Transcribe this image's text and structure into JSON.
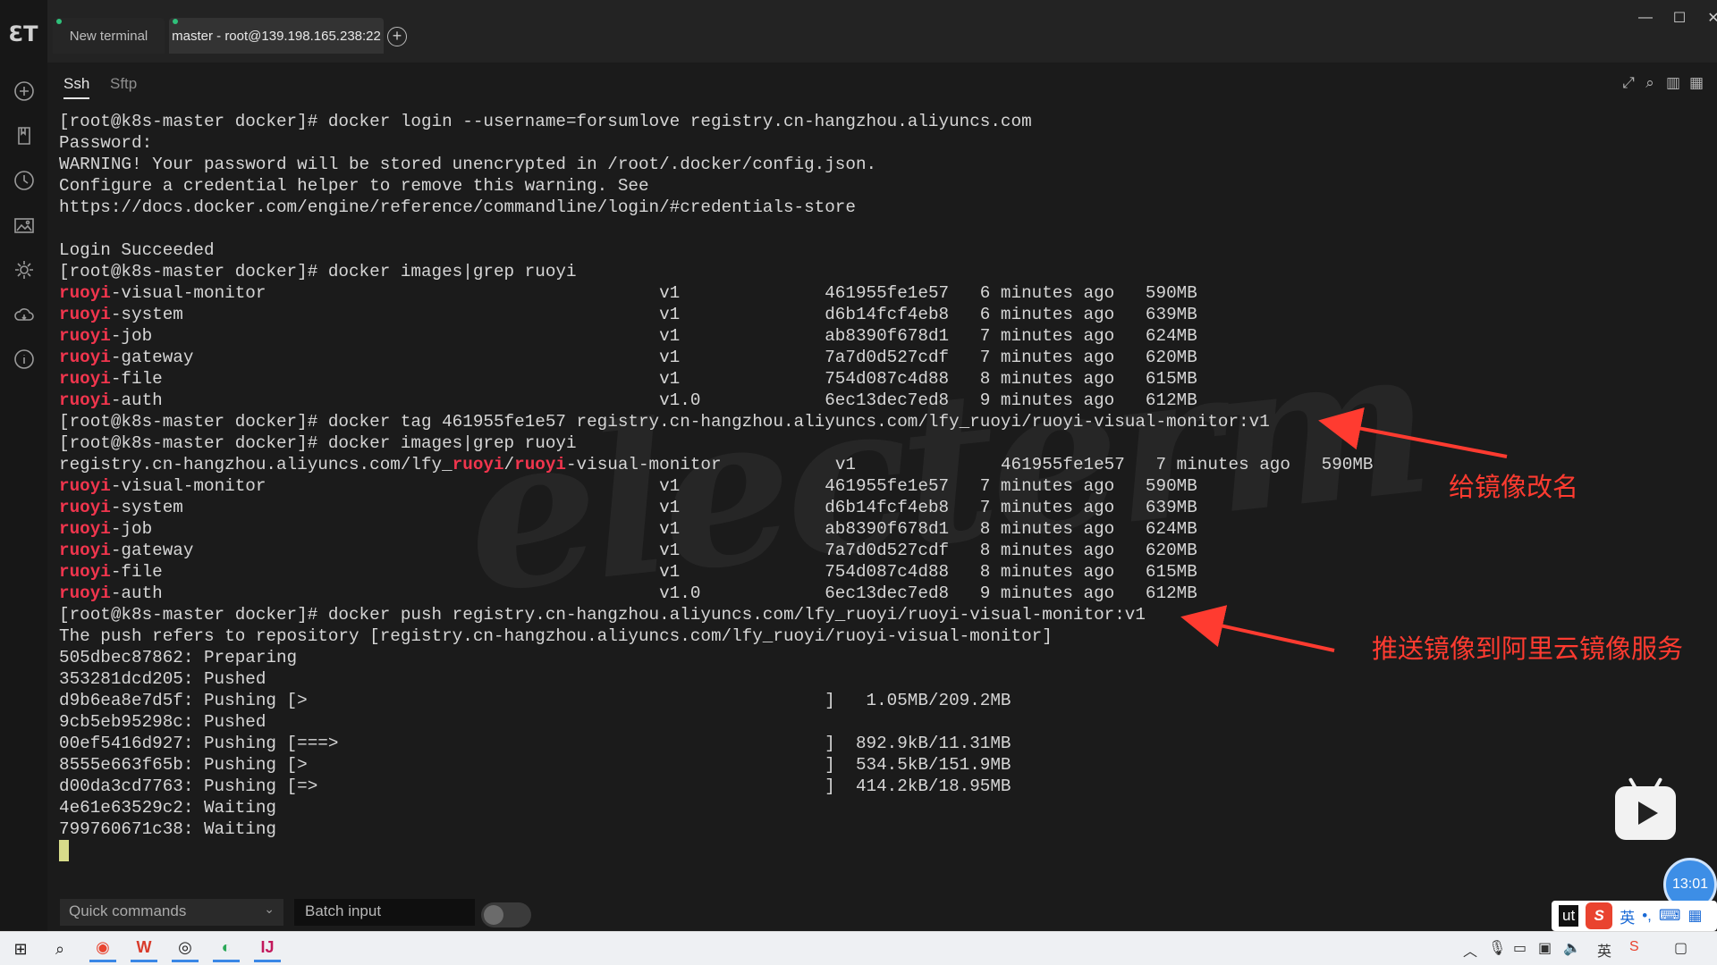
{
  "sidebar": {
    "items": [
      {
        "name": "add-icon"
      },
      {
        "name": "bookmark-icon"
      },
      {
        "name": "history-icon"
      },
      {
        "name": "image-icon"
      },
      {
        "name": "settings-icon"
      },
      {
        "name": "cloud-icon"
      },
      {
        "name": "info-icon"
      }
    ]
  },
  "tabs": [
    {
      "label": "New terminal",
      "status_color": "#2fc07a"
    },
    {
      "label": "master - root@139.198.165.238:22",
      "status_color": "#2fc07a"
    }
  ],
  "subtabs": [
    {
      "label": "Ssh",
      "active": true
    },
    {
      "label": "Sftp",
      "active": false
    }
  ],
  "terminal": {
    "highlight_color": "#f0354d",
    "lines": [
      {
        "parts": [
          {
            "t": "[root@k8s-master docker]# docker login --username=forsumlove registry.cn-hangzhou.aliyuncs.com"
          }
        ]
      },
      {
        "parts": [
          {
            "t": "Password:"
          }
        ]
      },
      {
        "parts": [
          {
            "t": "WARNING! Your password will be stored unencrypted in /root/.docker/config.json."
          }
        ]
      },
      {
        "parts": [
          {
            "t": "Configure a credential helper to remove this warning. See"
          }
        ]
      },
      {
        "parts": [
          {
            "t": "https://docs.docker.com/engine/reference/commandline/login/#credentials-store"
          }
        ]
      },
      {
        "parts": [
          {
            "t": ""
          }
        ]
      },
      {
        "parts": [
          {
            "t": "Login Succeeded"
          }
        ]
      },
      {
        "parts": [
          {
            "t": "[root@k8s-master docker]# docker images|grep ruoyi"
          }
        ]
      },
      {
        "parts": [
          {
            "t": "ruoyi",
            "h": true
          },
          {
            "t": "-visual-monitor                                      v1              461955fe1e57   6 minutes ago   590MB"
          }
        ]
      },
      {
        "parts": [
          {
            "t": "ruoyi",
            "h": true
          },
          {
            "t": "-system                                              v1              d6b14fcf4eb8   6 minutes ago   639MB"
          }
        ]
      },
      {
        "parts": [
          {
            "t": "ruoyi",
            "h": true
          },
          {
            "t": "-job                                                 v1              ab8390f678d1   7 minutes ago   624MB"
          }
        ]
      },
      {
        "parts": [
          {
            "t": "ruoyi",
            "h": true
          },
          {
            "t": "-gateway                                             v1              7a7d0d527cdf   7 minutes ago   620MB"
          }
        ]
      },
      {
        "parts": [
          {
            "t": "ruoyi",
            "h": true
          },
          {
            "t": "-file                                                v1              754d087c4d88   8 minutes ago   615MB"
          }
        ]
      },
      {
        "parts": [
          {
            "t": "ruoyi",
            "h": true
          },
          {
            "t": "-auth                                                v1.0            6ec13dec7ed8   9 minutes ago   612MB"
          }
        ]
      },
      {
        "parts": [
          {
            "t": "[root@k8s-master docker]# docker tag 461955fe1e57 registry.cn-hangzhou.aliyuncs.com/lfy_ruoyi/ruoyi-visual-monitor:v1"
          }
        ]
      },
      {
        "parts": [
          {
            "t": "[root@k8s-master docker]# docker images|grep ruoyi"
          }
        ]
      },
      {
        "parts": [
          {
            "t": "registry.cn-hangzhou.aliyuncs.com/lfy_"
          },
          {
            "t": "ruoyi",
            "h": true
          },
          {
            "t": "/"
          },
          {
            "t": "ruoyi",
            "h": true
          },
          {
            "t": "-visual-monitor           v1              461955fe1e57   7 minutes ago   590MB"
          }
        ]
      },
      {
        "parts": [
          {
            "t": "ruoyi",
            "h": true
          },
          {
            "t": "-visual-monitor                                      v1              461955fe1e57   7 minutes ago   590MB"
          }
        ]
      },
      {
        "parts": [
          {
            "t": "ruoyi",
            "h": true
          },
          {
            "t": "-system                                              v1              d6b14fcf4eb8   7 minutes ago   639MB"
          }
        ]
      },
      {
        "parts": [
          {
            "t": "ruoyi",
            "h": true
          },
          {
            "t": "-job                                                 v1              ab8390f678d1   8 minutes ago   624MB"
          }
        ]
      },
      {
        "parts": [
          {
            "t": "ruoyi",
            "h": true
          },
          {
            "t": "-gateway                                             v1              7a7d0d527cdf   8 minutes ago   620MB"
          }
        ]
      },
      {
        "parts": [
          {
            "t": "ruoyi",
            "h": true
          },
          {
            "t": "-file                                                v1              754d087c4d88   8 minutes ago   615MB"
          }
        ]
      },
      {
        "parts": [
          {
            "t": "ruoyi",
            "h": true
          },
          {
            "t": "-auth                                                v1.0            6ec13dec7ed8   9 minutes ago   612MB"
          }
        ]
      },
      {
        "parts": [
          {
            "t": "[root@k8s-master docker]# docker push registry.cn-hangzhou.aliyuncs.com/lfy_ruoyi/ruoyi-visual-monitor:v1"
          }
        ]
      },
      {
        "parts": [
          {
            "t": "The push refers to repository [registry.cn-hangzhou.aliyuncs.com/lfy_ruoyi/ruoyi-visual-monitor]"
          }
        ]
      },
      {
        "parts": [
          {
            "t": "505dbec87862: Preparing"
          }
        ]
      },
      {
        "parts": [
          {
            "t": "353281dcd205: Pushed"
          }
        ]
      },
      {
        "parts": [
          {
            "t": "d9b6ea8e7d5f: Pushing [>                                                  ]   1.05MB/209.2MB"
          }
        ]
      },
      {
        "parts": [
          {
            "t": "9cb5eb95298c: Pushed"
          }
        ]
      },
      {
        "parts": [
          {
            "t": "00ef5416d927: Pushing [===>                                               ]  892.9kB/11.31MB"
          }
        ]
      },
      {
        "parts": [
          {
            "t": "8555e663f65b: Pushing [>                                                  ]  534.5kB/151.9MB"
          }
        ]
      },
      {
        "parts": [
          {
            "t": "d00da3cd7763: Pushing [=>                                                 ]  414.2kB/18.95MB"
          }
        ]
      },
      {
        "parts": [
          {
            "t": "4e61e63529c2: Waiting"
          }
        ]
      },
      {
        "parts": [
          {
            "t": "799760671c38: Waiting"
          }
        ]
      }
    ]
  },
  "annotations": {
    "rename": "给镜像改名",
    "push": "推送镜像到阿里云镜像服务",
    "color": "#ff3b30"
  },
  "watermark": "electerm",
  "bottom": {
    "quick_commands_placeholder": "Quick commands",
    "batch_input_placeholder": "Batch input"
  },
  "overlay": {
    "clock": "13:01",
    "ime_text": "ut",
    "ime_lang": "英"
  }
}
